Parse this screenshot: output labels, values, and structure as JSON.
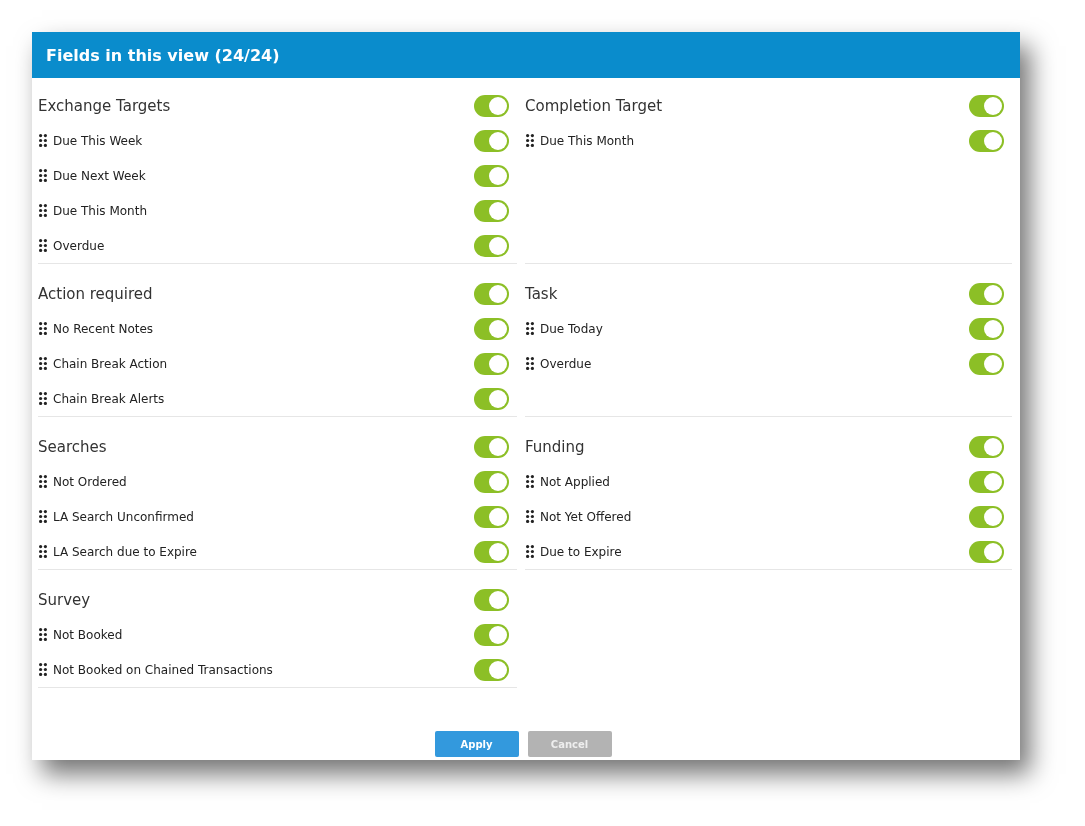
{
  "dialog": {
    "title": "Fields in this view (24/24)"
  },
  "sections": [
    {
      "title": "Exchange Targets",
      "on": true,
      "items": [
        {
          "label": "Due This Week",
          "on": true
        },
        {
          "label": "Due Next Week",
          "on": true
        },
        {
          "label": "Due This Month",
          "on": true
        },
        {
          "label": "Overdue",
          "on": true
        }
      ]
    },
    {
      "title": "Completion Target",
      "on": true,
      "items": [
        {
          "label": "Due This Month",
          "on": true
        }
      ]
    },
    {
      "title": "Action required",
      "on": true,
      "items": [
        {
          "label": "No Recent Notes",
          "on": true
        },
        {
          "label": "Chain Break Action",
          "on": true
        },
        {
          "label": "Chain Break Alerts",
          "on": true
        }
      ]
    },
    {
      "title": "Task",
      "on": true,
      "items": [
        {
          "label": "Due Today",
          "on": true
        },
        {
          "label": "Overdue",
          "on": true
        }
      ]
    },
    {
      "title": "Searches",
      "on": true,
      "items": [
        {
          "label": "Not Ordered",
          "on": true
        },
        {
          "label": "LA Search Unconfirmed",
          "on": true
        },
        {
          "label": "LA Search due to Expire",
          "on": true
        }
      ]
    },
    {
      "title": "Funding",
      "on": true,
      "items": [
        {
          "label": "Not Applied",
          "on": true
        },
        {
          "label": "Not Yet Offered",
          "on": true
        },
        {
          "label": "Due to Expire",
          "on": true
        }
      ]
    },
    {
      "title": "Survey",
      "on": true,
      "items": [
        {
          "label": "Not Booked",
          "on": true
        },
        {
          "label": "Not Booked on Chained Transactions",
          "on": true
        }
      ]
    }
  ],
  "buttons": [
    {
      "label": "Apply",
      "kind": "primary"
    },
    {
      "label": "Cancel",
      "kind": "secondary"
    }
  ]
}
